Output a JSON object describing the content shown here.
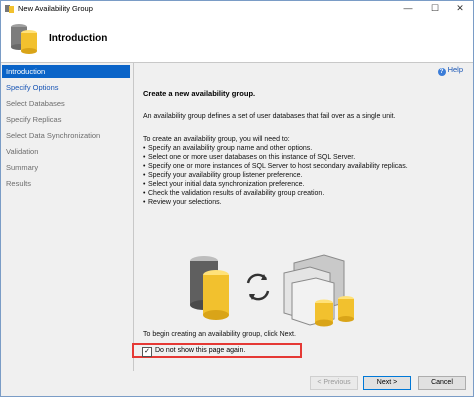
{
  "window": {
    "title": "New Availability Group"
  },
  "header": {
    "heading": "Introduction"
  },
  "sidebar": {
    "items": [
      {
        "label": "Introduction",
        "state": "active"
      },
      {
        "label": "Specify Options",
        "state": "link"
      },
      {
        "label": "Select Databases",
        "state": "disabled"
      },
      {
        "label": "Specify Replicas",
        "state": "disabled"
      },
      {
        "label": "Select Data Synchronization",
        "state": "disabled"
      },
      {
        "label": "Validation",
        "state": "disabled"
      },
      {
        "label": "Summary",
        "state": "disabled"
      },
      {
        "label": "Results",
        "state": "disabled"
      }
    ]
  },
  "content": {
    "help_label": "Help",
    "section_title": "Create a new availability group.",
    "description": "An availability group defines a set of user databases that fail over as a single unit.",
    "steps_intro": "To create an availability group, you will need to:",
    "steps": [
      "Specify an availability group name and other options.",
      "Select one or more user databases on this instance of SQL Server.",
      "Specify one or more instances of SQL Server to host secondary availability replicas.",
      "Specify your availability group listener preference.",
      "Select your initial data synchronization preference.",
      "Check the validation results of availability group creation.",
      "Review your selections."
    ],
    "begin_text": "To begin creating an availability group, click Next.",
    "checkbox_label": "Do not show this page again.",
    "checkbox_checked": true
  },
  "footer": {
    "previous_label": "< Previous",
    "next_label": "Next >",
    "cancel_label": "Cancel"
  },
  "colors": {
    "accent": "#0a64c8",
    "link": "#1a56b5",
    "highlight_border": "#e53935",
    "db_gold": "#f2c12e"
  }
}
